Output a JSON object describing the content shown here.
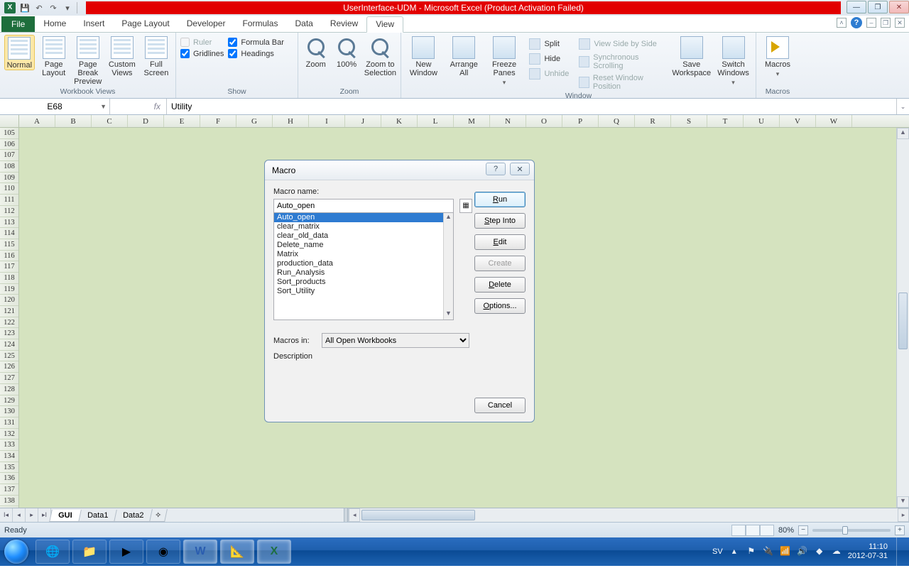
{
  "titlebar": {
    "title_left": "UserInterface-UDM",
    "title_mid": "  -  Microsoft Excel (Product Activation Failed)"
  },
  "tabs": {
    "file": "File",
    "items": [
      "Home",
      "Insert",
      "Page Layout",
      "Developer",
      "Formulas",
      "Data",
      "Review",
      "View"
    ],
    "active": "View"
  },
  "ribbon": {
    "workbook_views": {
      "label": "Workbook Views",
      "buttons": [
        "Normal",
        "Page Layout",
        "Page Break Preview",
        "Custom Views",
        "Full Screen"
      ]
    },
    "show": {
      "label": "Show",
      "ruler": "Ruler",
      "formula_bar": "Formula Bar",
      "gridlines": "Gridlines",
      "headings": "Headings"
    },
    "zoom": {
      "label": "Zoom",
      "zoom": "Zoom",
      "p100": "100%",
      "zts": "Zoom to Selection"
    },
    "window": {
      "label": "Window",
      "new": "New Window",
      "arrange": "Arrange All",
      "freeze": "Freeze Panes",
      "split": "Split",
      "hide": "Hide",
      "unhide": "Unhide",
      "sbs": "View Side by Side",
      "sync": "Synchronous Scrolling",
      "reset": "Reset Window Position",
      "save": "Save Workspace",
      "switch": "Switch Windows"
    },
    "macros": {
      "label": "Macros",
      "btn": "Macros"
    }
  },
  "formula_bar": {
    "namebox": "E68",
    "fx": "fx",
    "value": "Utility"
  },
  "columns": [
    "A",
    "B",
    "C",
    "D",
    "E",
    "F",
    "G",
    "H",
    "I",
    "J",
    "K",
    "L",
    "M",
    "N",
    "O",
    "P",
    "Q",
    "R",
    "S",
    "T",
    "U",
    "V",
    "W"
  ],
  "row_start": 105,
  "row_end": 138,
  "sheet_tabs": {
    "active": "GUI",
    "items": [
      "GUI",
      "Data1",
      "Data2"
    ]
  },
  "statusbar": {
    "status": "Ready",
    "zoom": "80%"
  },
  "taskbar": {
    "lang": "SV",
    "time": "11:10",
    "date": "2012-07-31"
  },
  "dialog": {
    "title": "Macro",
    "name_label": "Macro name:",
    "name_value": "Auto_open",
    "list": [
      "Auto_open",
      "clear_matrix",
      "clear_old_data",
      "Delete_name",
      "Matrix",
      "production_data",
      "Run_Analysis",
      "Sort_products",
      "Sort_Utility"
    ],
    "selected": "Auto_open",
    "macros_in_label": "Macros in:",
    "macros_in_value": "All Open Workbooks",
    "description_label": "Description",
    "buttons": {
      "run": "Run",
      "stepinto": "Step Into",
      "edit": "Edit",
      "create": "Create",
      "delete": "Delete",
      "options": "Options...",
      "cancel": "Cancel"
    }
  }
}
